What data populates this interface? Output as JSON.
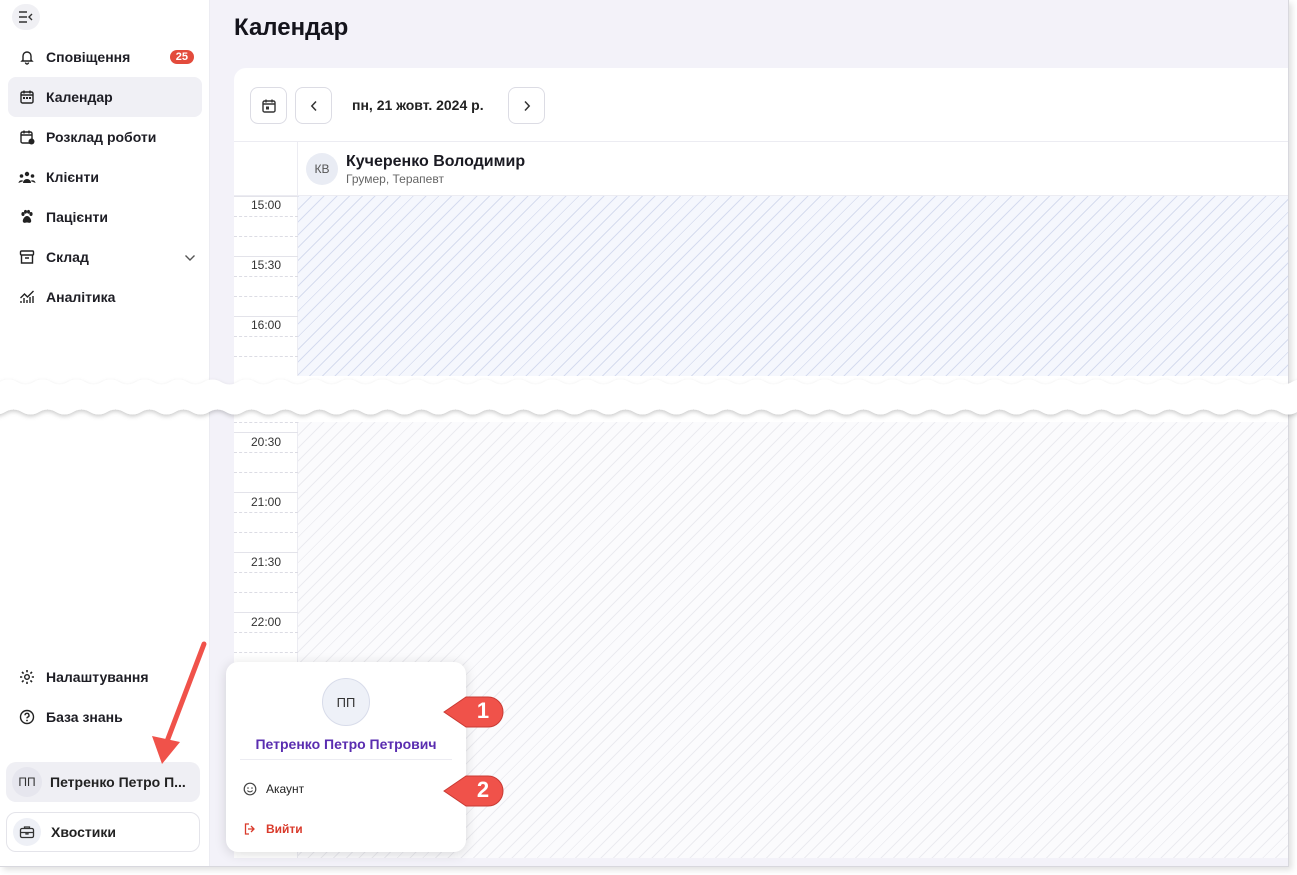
{
  "sidebar": {
    "items": [
      {
        "label": "Сповіщення",
        "icon": "bell-icon",
        "badge": "25"
      },
      {
        "label": "Календар",
        "icon": "calendar-icon",
        "active": true
      },
      {
        "label": "Розклад роботи",
        "icon": "schedule-icon"
      },
      {
        "label": "Клієнти",
        "icon": "users-icon"
      },
      {
        "label": "Пацієнти",
        "icon": "paw-icon"
      },
      {
        "label": "Склад",
        "icon": "archive-icon",
        "expandable": true
      },
      {
        "label": "Аналітика",
        "icon": "chart-icon"
      }
    ],
    "settings_label": "Налаштування",
    "knowledge_label": "База знань",
    "user": {
      "initials": "ПП",
      "name": "Петренко Петро П..."
    },
    "org": {
      "name": "Хвостики"
    }
  },
  "main": {
    "title": "Календар",
    "date_label": "пн, 21 жовт. 2024 р.",
    "staff": {
      "initials": "КВ",
      "name": "Кучеренко Володимир",
      "role": "Грумер, Терапевт"
    },
    "times_top": [
      "15:00",
      "15:30",
      "16:00"
    ],
    "times_bottom": [
      "20:30",
      "21:00",
      "21:30",
      "22:00"
    ]
  },
  "popup": {
    "initials": "ПП",
    "name": "Петренко Петро Петрович",
    "account_label": "Акаунт",
    "logout_label": "Вийти"
  },
  "callouts": [
    "1",
    "2"
  ],
  "colors": {
    "accent": "#5a2db0",
    "badge": "#e34b3c",
    "logout": "#d93a2b",
    "callout": "#f0524a"
  }
}
